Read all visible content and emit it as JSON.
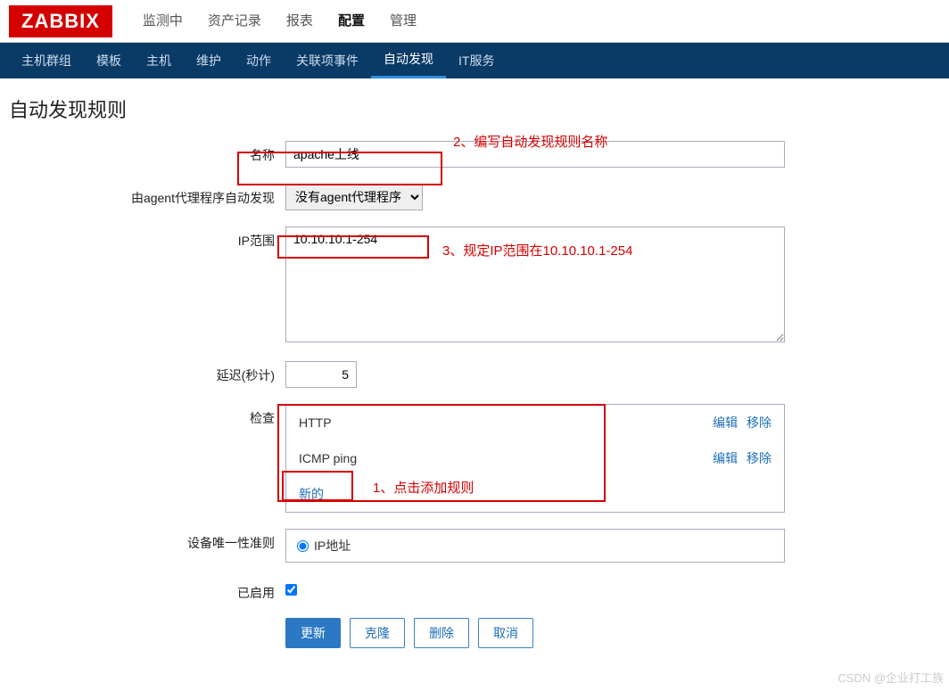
{
  "logo": "ZABBIX",
  "topnav": {
    "items": [
      "监测中",
      "资产记录",
      "报表",
      "配置",
      "管理"
    ],
    "active_index": 3
  },
  "subnav": {
    "items": [
      "主机群组",
      "模板",
      "主机",
      "维护",
      "动作",
      "关联项事件",
      "自动发现",
      "IT服务"
    ],
    "active_index": 6
  },
  "page_title": "自动发现规则",
  "form": {
    "name_label": "名称",
    "name_value": "apache上线",
    "proxy_label": "由agent代理程序自动发现",
    "proxy_selected": "没有agent代理程序",
    "iprange_label": "IP范围",
    "iprange_value": "10.10.10.1-254",
    "delay_label": "延迟(秒计)",
    "delay_value": "5",
    "checks_label": "检查",
    "checks": [
      {
        "name": "HTTP",
        "edit": "编辑",
        "remove": "移除"
      },
      {
        "name": "ICMP ping",
        "edit": "编辑",
        "remove": "移除"
      }
    ],
    "new_link": "新的",
    "unique_label": "设备唯一性准则",
    "unique_radio": "IP地址",
    "enabled_label": "已启用",
    "enabled_checked": true
  },
  "buttons": {
    "update": "更新",
    "clone": "克隆",
    "delete": "删除",
    "cancel": "取消"
  },
  "annotations": {
    "a1": "1、点击添加规则",
    "a2": "2、编写自动发现规则名称",
    "a3": "3、规定IP范围在10.10.10.1-254"
  },
  "watermark": "CSDN @企业打工族"
}
